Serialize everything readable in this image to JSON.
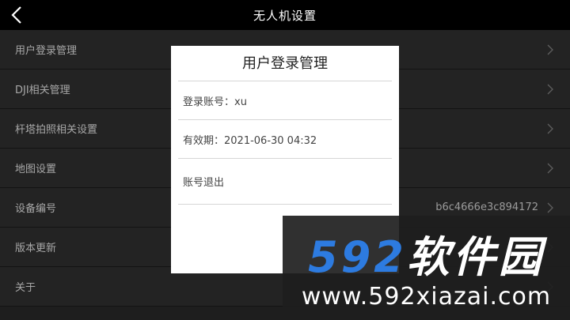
{
  "header": {
    "title": "无人机设置"
  },
  "settings": [
    {
      "label": "用户登录管理",
      "value": ""
    },
    {
      "label": "DJI相关管理",
      "value": ""
    },
    {
      "label": "杆塔拍照相关设置",
      "value": ""
    },
    {
      "label": "地图设置",
      "value": ""
    },
    {
      "label": "设备编号",
      "value": "b6c4666e3c894172"
    },
    {
      "label": "版本更新",
      "value": ""
    },
    {
      "label": "关于",
      "value": ""
    }
  ],
  "dialog": {
    "title": "用户登录管理",
    "account": "登录账号：xu",
    "expiry": "有效期：2021-06-30 04:32",
    "logout": "账号退出"
  },
  "watermark": {
    "logo_digits": "592",
    "logo_text": "软件园",
    "url": "www.592xiazai.com"
  },
  "colors": {
    "accent": "#2d7be0",
    "background": "#333333"
  },
  "icons": {
    "back": "chevron-left-icon",
    "row": "chevron-right-icon"
  }
}
